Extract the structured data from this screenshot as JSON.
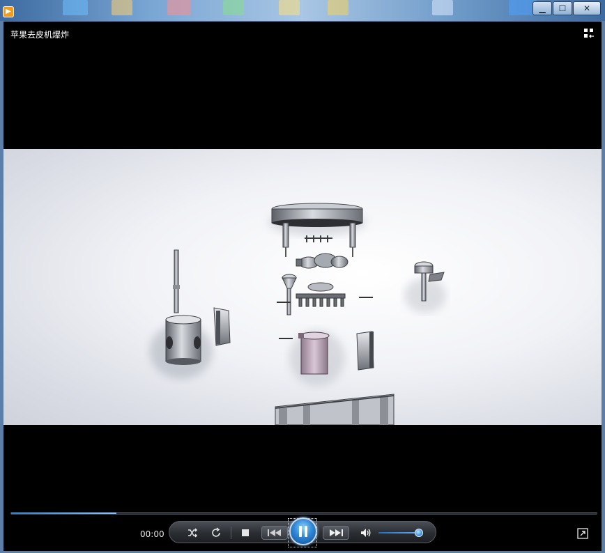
{
  "window": {
    "title": "苹果去皮机爆炸",
    "app_icon_glyph": "▶",
    "buttons": {
      "minimize": "▁",
      "maximize": "☐",
      "close": "✕"
    }
  },
  "player": {
    "current_time": "00:00",
    "progress_fraction": 0.18,
    "volume_fraction": 0.9,
    "state": "playing"
  },
  "icons": {
    "shuffle": "shuffle-icon",
    "repeat": "repeat-icon",
    "stop": "stop-icon",
    "previous": "previous-icon",
    "pause": "pause-icon",
    "next": "next-icon",
    "volume": "volume-icon",
    "expand": "expand-icon",
    "layout": "switch-view-icon"
  },
  "colors": {
    "accent": "#2f86d6",
    "video_bg": "#f1f2f6",
    "part_pink": "#c9b3c6"
  }
}
